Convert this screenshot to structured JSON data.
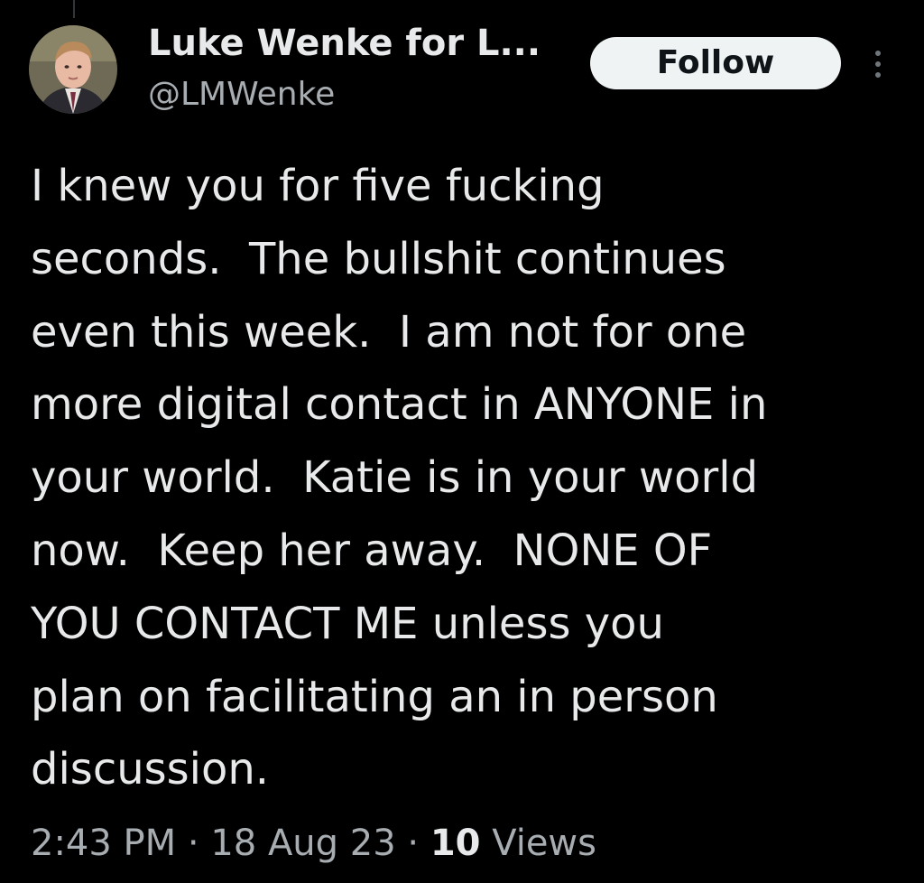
{
  "author": {
    "display_name": "Luke Wenke for L...",
    "handle": "@LMWenke"
  },
  "actions": {
    "follow_label": "Follow",
    "more_icon": "more-vertical-icon"
  },
  "tweet": {
    "lines": [
      "I knew you for five fucking",
      "seconds.  The bullshit continues",
      "even this week.  I am not for one",
      "more digital contact in ANYONE in",
      "your world.  Katie is in your world",
      "now.  Keep her away.  NONE OF",
      "YOU CONTACT ME unless you",
      "plan on facilitating an in person",
      "discussion."
    ]
  },
  "meta": {
    "time": "2:43 PM",
    "separator": "·",
    "date": "18 Aug 23",
    "views_count": "10",
    "views_label": "Views"
  },
  "colors": {
    "background": "#000000",
    "primary_text": "#e7e9ea",
    "secondary_text": "#a8adb2",
    "follow_bg": "#eff3f4",
    "follow_text": "#0f1419"
  }
}
